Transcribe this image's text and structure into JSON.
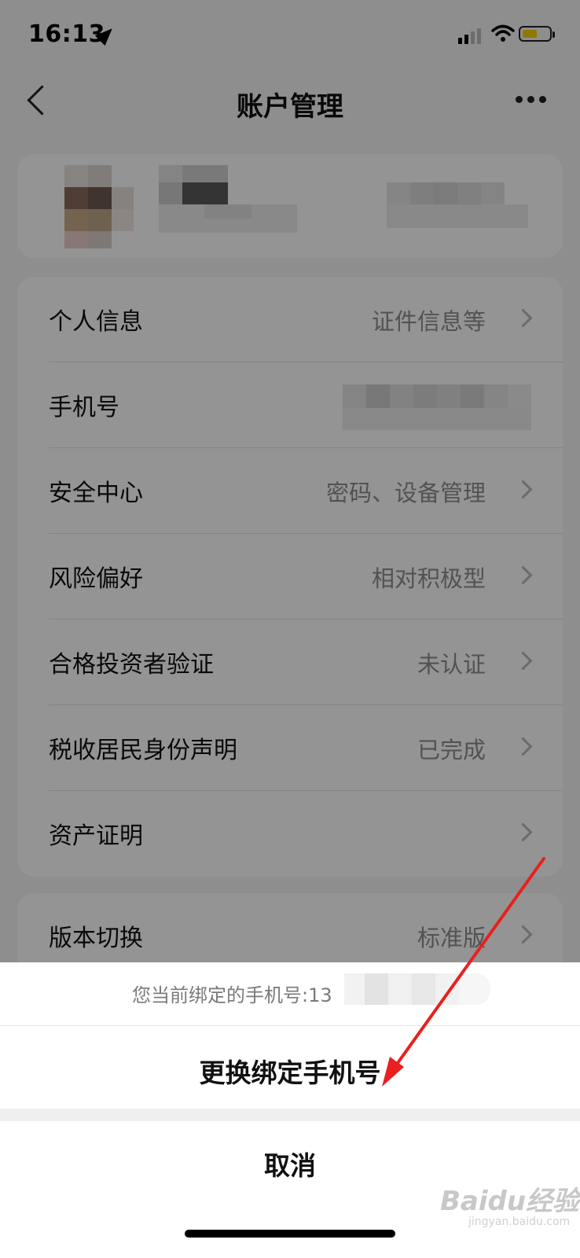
{
  "status_bar": {
    "time": "16:13",
    "icons": [
      "location-arrow-icon",
      "cellular-signal-icon",
      "wifi-icon",
      "battery-icon"
    ]
  },
  "nav": {
    "title": "账户管理",
    "back_icon": "chevron-left-icon",
    "more_icon": "more-dots-icon"
  },
  "account_items": [
    {
      "label": "个人信息",
      "value": "证件信息等"
    },
    {
      "label": "手机号",
      "value": ""
    },
    {
      "label": "安全中心",
      "value": "密码、设备管理"
    },
    {
      "label": "风险偏好",
      "value": "相对积极型"
    },
    {
      "label": "合格投资者验证",
      "value": "未认证"
    },
    {
      "label": "税收居民身份声明",
      "value": "已完成"
    },
    {
      "label": "资产证明",
      "value": ""
    }
  ],
  "version_item": {
    "label": "版本切换",
    "value": "标准版"
  },
  "action_sheet": {
    "info_text": "您当前绑定的手机号:13",
    "primary_action": "更换绑定手机号",
    "cancel": "取消"
  },
  "watermark": {
    "text": "Baidu经验",
    "sub": "jingyan.baidu.com"
  },
  "colors": {
    "annotation_arrow": "#e8201f",
    "battery": "#f3d100"
  }
}
